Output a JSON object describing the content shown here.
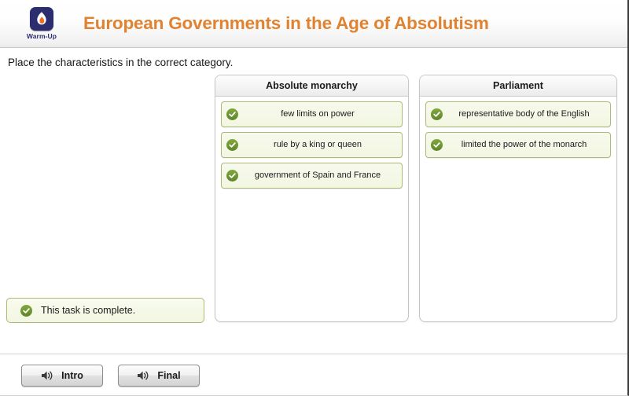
{
  "header": {
    "brand_label": "Warm-Up",
    "brand_icon": "flame-icon",
    "title": "European Governments in the Age of Absolutism",
    "title_color": "#e0822f",
    "brand_tile_color": "#2b2d6e"
  },
  "instruction": "Place the characteristics in the correct category.",
  "categories": [
    {
      "title": "Absolute monarchy",
      "items": [
        {
          "label": "few limits on power",
          "icon": "check-circle-icon"
        },
        {
          "label": "rule by a king or queen",
          "icon": "check-circle-icon"
        },
        {
          "label": "government of Spain and France",
          "icon": "check-circle-icon"
        }
      ]
    },
    {
      "title": "Parliament",
      "items": [
        {
          "label": "representative body of the English",
          "icon": "check-circle-icon"
        },
        {
          "label": "limited the power of the monarch",
          "icon": "check-circle-icon"
        }
      ]
    }
  ],
  "status": {
    "text": "This task is complete.",
    "icon": "check-circle-icon",
    "accent_color": "#6d9430"
  },
  "footer": {
    "buttons": [
      {
        "label": "Intro",
        "icon": "speaker-icon"
      },
      {
        "label": "Final",
        "icon": "speaker-icon"
      }
    ]
  }
}
